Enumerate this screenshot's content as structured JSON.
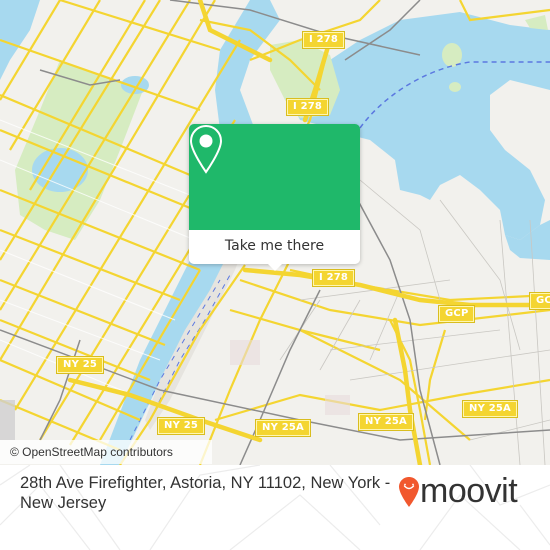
{
  "map": {
    "road_shields": [
      {
        "id": "i278-top",
        "label": "I 278"
      },
      {
        "id": "i278-mid",
        "label": "I 278"
      },
      {
        "id": "i278-right",
        "label": "I 278"
      },
      {
        "id": "gcp-1",
        "label": "GCP"
      },
      {
        "id": "gcp-2",
        "label": "GCP"
      },
      {
        "id": "ny25-1",
        "label": "NY 25"
      },
      {
        "id": "ny25-2",
        "label": "NY 25"
      },
      {
        "id": "ny25a-1",
        "label": "NY 25A"
      },
      {
        "id": "ny25a-2",
        "label": "NY 25A"
      },
      {
        "id": "ny25a-3",
        "label": "NY 25A"
      }
    ],
    "attribution": "© OpenStreetMap contributors",
    "colors": {
      "land": "#f2f1ed",
      "water": "#a7d9ef",
      "park": "#d6ecc1",
      "road_major": "#f4d531",
      "rail": "#8c8c8c",
      "ferry": "#5b78e0"
    }
  },
  "popup": {
    "icon": "map-pin-icon",
    "button_label": "Take me there",
    "accent_color": "#1fb86a"
  },
  "footer": {
    "address": "28th Ave Firefighter, Astoria, NY 11102, New York - New Jersey",
    "brand": "moovit",
    "brand_color": "#f1582e"
  }
}
